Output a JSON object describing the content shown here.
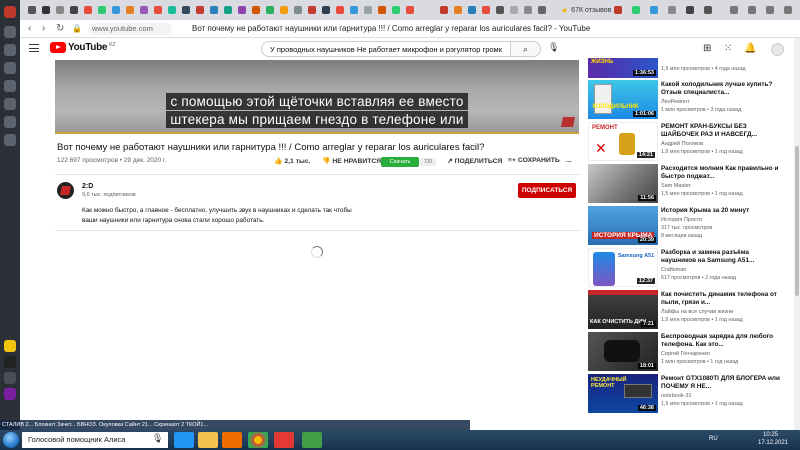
{
  "browser": {
    "url": "www.youtube.com",
    "page_title": "Вот почему не работают наушники или гарнитура !!! / Como arreglar y reparar los auriculares facil? - YouTube",
    "review_badge": "67К отзывов",
    "rating_star": "★"
  },
  "yt": {
    "logo_text": "YouTube",
    "logo_cc": "KZ",
    "search_value": "У проводных наушников Не работает микрофон и рэгулятор громк",
    "search_icon": "⌕",
    "mic_icon": "🎙"
  },
  "video": {
    "subtitle_line1": "с помощью этой щёточки вставляя ее вместо",
    "subtitle_line2": "штекера мы прищаем гнездо в телефоне или",
    "title": "Вот почему не работают наушники или гарнитура !!! / Como arreglar y reparar los auriculares facil?",
    "meta": "122 697 просмотров • 29 дек. 2020 г.",
    "likes": "2,1 тыс.",
    "dislike_label": "НЕ НРАВИТСЯ",
    "save_green": "Скачать",
    "rating_pill": "720",
    "share_label": "ПОДЕЛИТЬСЯ",
    "save_label": "СОХРАНИТЬ",
    "more": "..."
  },
  "channel": {
    "name": "2:D",
    "subscribers": "9,6 тыс. подписчиков",
    "subscribe_label": "ПОДПИСАТЬСЯ",
    "description_line1": "Как можно быстро, а главное - бесплатно, улучшить звук в наушниках и сделать так чтобы",
    "description_line2": "ваши наушники или гарнитура снова стали хорошо работать."
  },
  "recommendations": [
    {
      "title": "",
      "channel": "",
      "meta": "1,9 млн просмотров • 4 года назад",
      "duration": "1:36:53",
      "thumb_text": "ЖИЗНЬ"
    },
    {
      "title": "Какой холодильник лучше купить? Отзыв специалиста...",
      "channel": "ЛенРемонт",
      "meta": "1 млн просмотров • 3 года назад",
      "duration": "1:01:06",
      "thumb_text": "ХОЛОДИЛЬНИК"
    },
    {
      "title": "РЕМОНТ КРАН-БУКСЫ БЕЗ ШАЙБОЧЕК РАЗ И НАВСЕГД...",
      "channel": "Андрей Поляков",
      "meta": "1,9 млн просмотров • 1 год назад",
      "duration": "14:21",
      "thumb_text": "РЕМОНТ"
    },
    {
      "title": "Расходится молния Как правильно и быстро поджат...",
      "channel": "Sam Master",
      "meta": "1,5 млн просмотров • 1 год назад",
      "duration": "11:56",
      "thumb_text": ""
    },
    {
      "title": "История Крыма за 20 минут",
      "channel": "История Просто",
      "meta": "317 тыс. просмотров",
      "meta2": "8 месяцев назад",
      "duration": "20:39",
      "thumb_text": "ИСТОРИЯ КРЫМА"
    },
    {
      "title": "Разборка и замена разъёма наушников на Samsung A51...",
      "channel": "Craftsman",
      "meta": "617 просмотров • 2 года назад",
      "duration": "12:37",
      "thumb_text": "Samsung A51"
    },
    {
      "title": "Как почистить динамик телефона от пыли, грязи и...",
      "channel": "Лайфы на все случаи жизни",
      "meta": "1,9 млн просмотров • 1 год назад",
      "duration": "7:21",
      "thumb_text": "КАК ОЧИСТИТЬ ДИН"
    },
    {
      "title": "Беспроводная зарядка для любого телефона. Как это...",
      "channel": "Сергей Гончаренко",
      "meta": "1 млн просмотров • 1 год назад",
      "duration": "18:01",
      "thumb_text": ""
    },
    {
      "title": "Ремонт GTX1080TI ДЛЯ БЛОГЕРА или ПОЧЕМУ Я НЕ...",
      "channel": "notebook-31",
      "meta": "1,9 млн просмотров • 1 год назад",
      "duration": "46:38",
      "thumb_text": "НЕУДАЧНЫЙ РЕМОНТ"
    }
  ],
  "taskbar": {
    "alice_placeholder": "Голосовой помощник Алиса",
    "lang": "RU",
    "time": "10:25",
    "date": "17.12.2021",
    "desktop_strip": "СТАЛИВ 2... Блокнот Зачет... БВНОЗ. Окуловка Сайнт 21... Скриншот 2 ТКОЙ1..."
  },
  "colors": {
    "yt_red": "#ff0000",
    "subscribe": "#cc0000",
    "save_green": "#2aae3d",
    "taskbar": "#1e3a58"
  }
}
